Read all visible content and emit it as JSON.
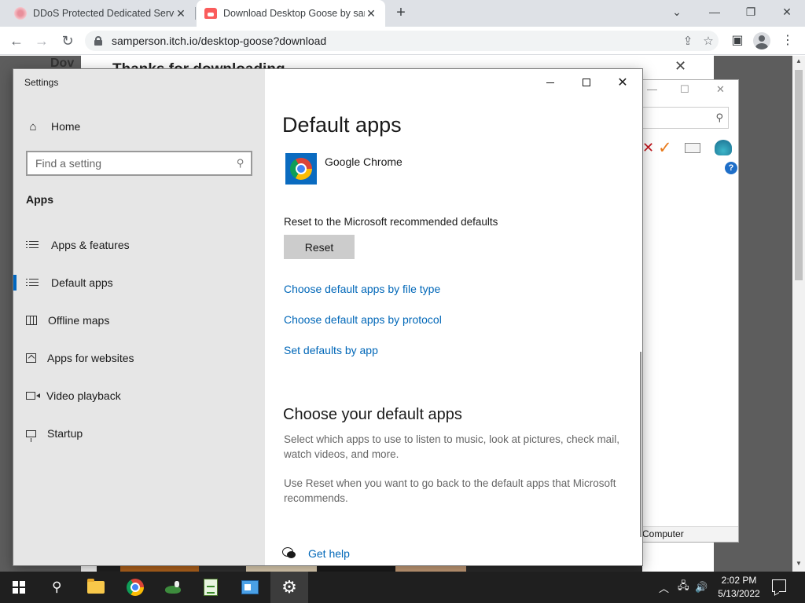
{
  "browser": {
    "tabs": [
      {
        "title": "DDoS Protected Dedicated Serve",
        "icon": "flower-favicon-icon",
        "active": false
      },
      {
        "title": "Download Desktop Goose by sar",
        "icon": "itch-favicon-icon",
        "active": true
      }
    ],
    "new_tab_glyph": "+",
    "url": "samperson.itch.io/desktop-goose?download"
  },
  "page": {
    "heading": "Thanks for downloading",
    "left_fragment": "Dov"
  },
  "background_window": {
    "status_text": "Computer",
    "help_glyph": "?"
  },
  "settings": {
    "window_title": "Settings",
    "home_label": "Home",
    "search_placeholder": "Find a setting",
    "section_label": "Apps",
    "nav_items": [
      {
        "label": "Apps & features",
        "icon": "apps-features-icon"
      },
      {
        "label": "Default apps",
        "icon": "default-apps-icon",
        "selected": true
      },
      {
        "label": "Offline maps",
        "icon": "offline-maps-icon"
      },
      {
        "label": "Apps for websites",
        "icon": "apps-for-websites-icon"
      },
      {
        "label": "Video playback",
        "icon": "video-playback-icon"
      },
      {
        "label": "Startup",
        "icon": "startup-icon"
      }
    ],
    "content": {
      "title": "Default apps",
      "default_web_browser": "Google Chrome",
      "reset_label": "Reset to the Microsoft recommended defaults",
      "reset_button": "Reset",
      "links": [
        "Choose default apps by file type",
        "Choose default apps by protocol",
        "Set defaults by app"
      ],
      "subheading": "Choose your default apps",
      "paragraph_1": "Select which apps to use to listen to music, look at pictures, check mail, watch videos, and more.",
      "paragraph_2": "Use Reset when you want to go back to the default apps that Microsoft recommends.",
      "help_link": "Get help"
    }
  },
  "taskbar": {
    "time": "2:02 PM",
    "date": "5/13/2022",
    "items": [
      "start",
      "search",
      "file-explorer",
      "chrome",
      "desktop-goose",
      "notepad",
      "app-window",
      "settings"
    ]
  },
  "colors": {
    "accent": "#0067c0",
    "link": "#0067b8",
    "sidebar_bg": "#e6e6e6",
    "taskbar_bg": "#1f1f1f"
  }
}
